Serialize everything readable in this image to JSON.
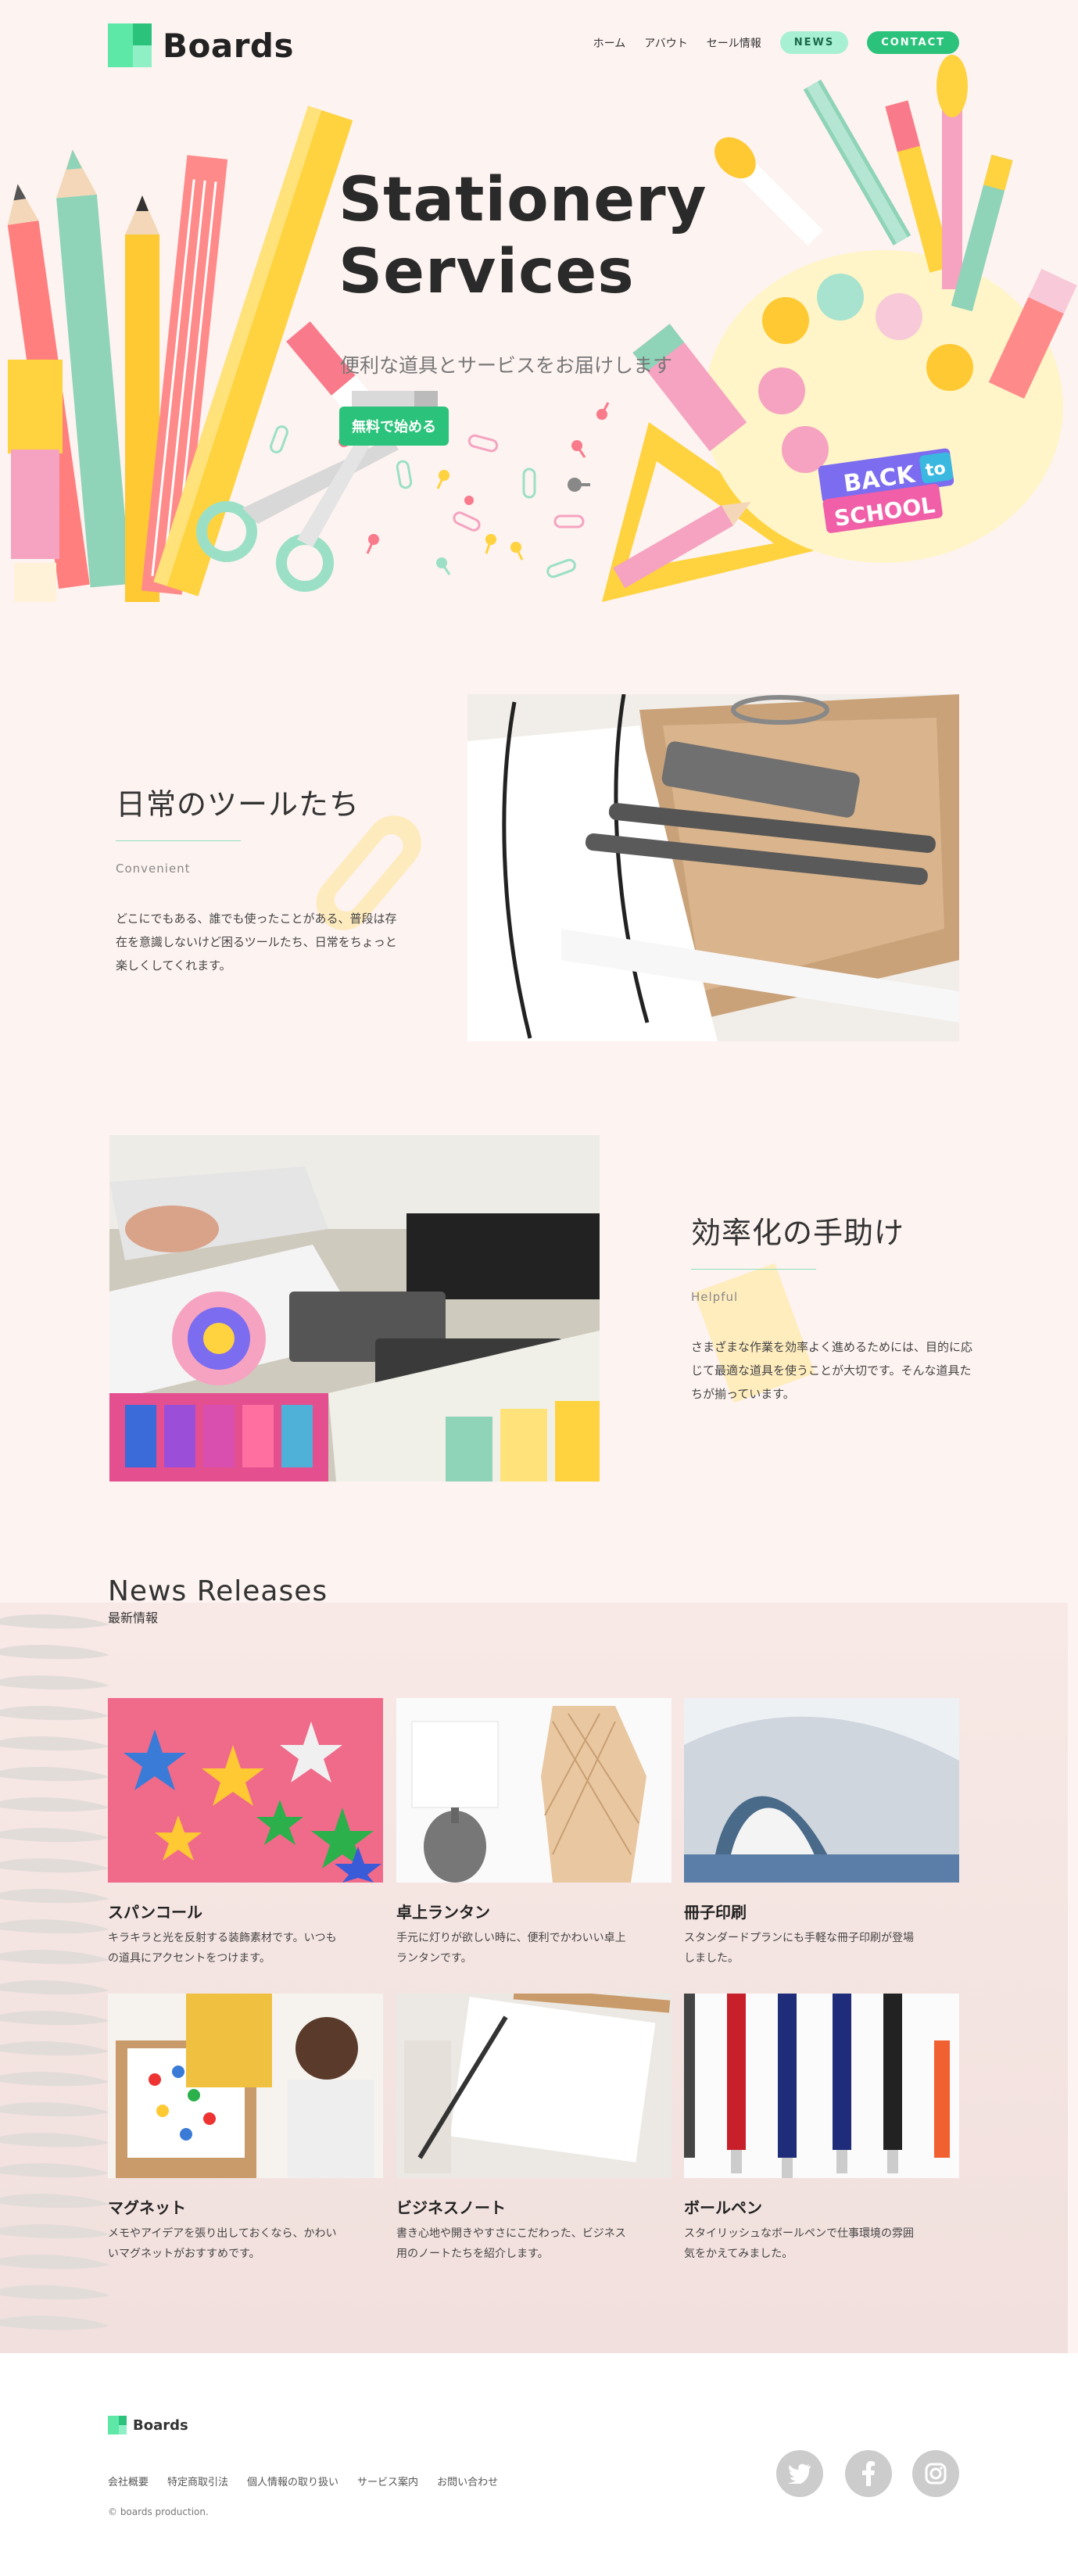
{
  "brand": {
    "name": "Boards"
  },
  "nav": {
    "items": [
      "ホーム",
      "アバウト",
      "セール情報"
    ],
    "news": "NEWS",
    "contact": "CONTACT"
  },
  "hero": {
    "title_line1": "Stationery",
    "title_line2": "Services",
    "subtitle": "便利な道具とサービスをお届けします",
    "cta": "無料で始める",
    "badge_line1": "BACK",
    "badge_to": "to",
    "badge_line2": "SCHOOL"
  },
  "features": [
    {
      "title": "日常のツールたち",
      "subtitle": "Convenient",
      "body": "どこにでもある、誰でも使ったことがある、普段は存在を意識しないけど困るツールたち、日常をちょっと楽しくしてくれます。"
    },
    {
      "title": "効率化の手助け",
      "subtitle": "Helpful",
      "body": "さまざまな作業を効率よく進めるためには、目的に応じて最適な道具を使うことが大切です。そんな道具たちが揃っています。"
    }
  ],
  "news": {
    "heading": "News Releases",
    "subheading": "最新情報",
    "items": [
      {
        "title": "スパンコール",
        "text": "キラキラと光を反射する装飾素材です。いつもの道具にアクセントをつけます。"
      },
      {
        "title": "卓上ランタン",
        "text": "手元に灯りが欲しい時に、便利でかわいい卓上ランタンです。"
      },
      {
        "title": "冊子印刷",
        "text": "スタンダードプランにも手軽な冊子印刷が登場しました。"
      },
      {
        "title": "マグネット",
        "text": "メモやアイデアを張り出しておくなら、かわいいマグネットがおすすめです。"
      },
      {
        "title": "ビジネスノート",
        "text": "書き心地や開きやすさにこだわった、ビジネス用のノートたちを紹介します。"
      },
      {
        "title": "ボールペン",
        "text": "スタイリッシュなボールペンで仕事環境の雰囲気をかえてみました。"
      }
    ]
  },
  "footer": {
    "brand": "Boards",
    "links": [
      "会社概要",
      "特定商取引法",
      "個人情報の取り扱い",
      "サービス案内",
      "お問い合わせ"
    ],
    "copyright": "© boards production.",
    "social": [
      "twitter-icon",
      "facebook-icon",
      "instagram-icon"
    ]
  },
  "colors": {
    "accent": "#2bc27b",
    "mint": "#5ee8a8",
    "background": "#fdf3f1",
    "yellow": "#ffd23f",
    "pink": "#f5a3c0"
  }
}
